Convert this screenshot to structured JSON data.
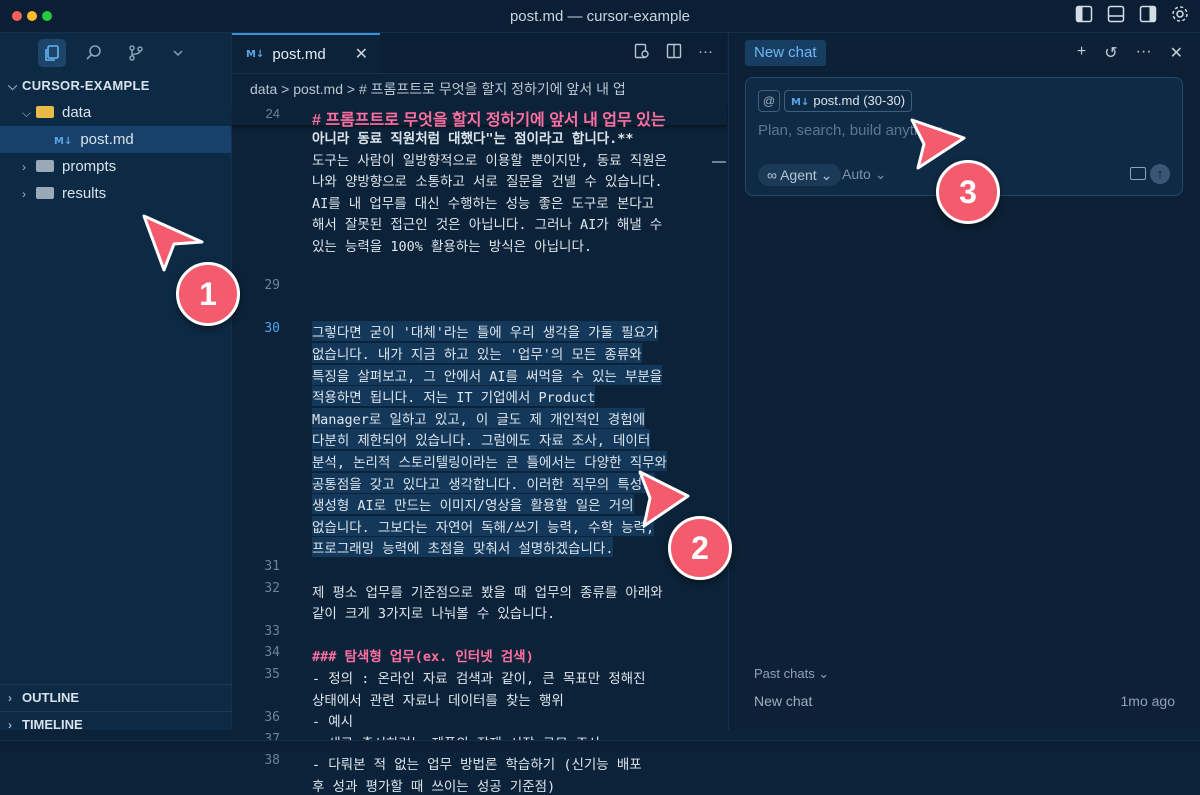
{
  "window": {
    "title": "post.md — cursor-example",
    "colors": {
      "close": "#ff5f57",
      "minimize": "#febc2e",
      "zoom": "#28c840",
      "accent": "#3b8ede",
      "marker": "#f45b6d"
    }
  },
  "sidebar": {
    "activity_icons": [
      "explorer-icon",
      "search-icon",
      "source-control-icon",
      "chevron-down-icon"
    ],
    "section_title": "CURSOR-EXAMPLE",
    "tree": [
      {
        "label": "data",
        "type": "folder",
        "open": true
      },
      {
        "label": "post.md",
        "type": "md-file",
        "selected": true
      },
      {
        "label": "prompts",
        "type": "folder",
        "open": false
      },
      {
        "label": "results",
        "type": "folder",
        "open": false
      }
    ],
    "outline": "OUTLINE",
    "timeline": "TIMELINE"
  },
  "editor": {
    "tab_label": "post.md",
    "tab_close": "✕",
    "breadcrumb": "data > post.md > # 프롬프트로 무엇을 할지 정하기에 앞서 내 업",
    "sticky_header": "# 프롬프트로 무엇을 할지 정하기에 앞서 내 업무 있는",
    "lines": [
      {
        "n": "",
        "t": "아니라 동료 직원처럼 대했다\"는 점이라고 합니다.**",
        "style": "bold"
      },
      {
        "n": "",
        "t": "도구는 사람이 일방향적으로 이용할 뿐이지만, 동료 직원은"
      },
      {
        "n": "",
        "t": "나와 양방향으로 소통하고 서로 질문을 건넬 수 있습니다."
      },
      {
        "n": "",
        "t": "AI를 내 업무를 대신 수행하는 성능 좋은 도구로 본다고"
      },
      {
        "n": "",
        "t": "해서 잘못된 접근인 것은 아닙니다. 그러나 AI가 해낼 수"
      },
      {
        "n": "",
        "t": "있는 능력을 100% 활용하는 방식은 아닙니다."
      },
      {
        "n": "",
        "t": ""
      },
      {
        "n": "29",
        "t": ""
      },
      {
        "n": "",
        "t": ""
      },
      {
        "n": "30",
        "t": "그렇다면 굳이 '대체'라는 틀에 우리 생각을 가둘 필요가",
        "style": "hl",
        "cur": true
      },
      {
        "n": "",
        "t": "없습니다. 내가 지금 하고 있는 '업무'의 모든 종류와",
        "style": "hl"
      },
      {
        "n": "",
        "t": "특징을 살펴보고, 그 안에서 AI를 써먹을 수 있는 부분을",
        "style": "hl"
      },
      {
        "n": "",
        "t": "적용하면 됩니다. 저는 IT 기업에서 Product",
        "style": "hl"
      },
      {
        "n": "",
        "t": "Manager로 일하고 있고, 이 글도 제 개인적인 경험에",
        "style": "hl"
      },
      {
        "n": "",
        "t": "다분히 제한되어 있습니다. 그럼에도 자료 조사, 데이터",
        "style": "hl"
      },
      {
        "n": "",
        "t": "분석, 논리적 스토리텔링이라는 큰 틀에서는 다양한 직무와",
        "style": "hl"
      },
      {
        "n": "",
        "t": "공통점을 갖고 있다고 생각합니다. 이러한 직무의 특성상",
        "style": "hl"
      },
      {
        "n": "",
        "t": "생성형 AI로 만드는 이미지/영상을 활용할 일은 거의",
        "style": "hl"
      },
      {
        "n": "",
        "t": "없습니다. 그보다는 자연어 독해/쓰기 능력, 수학 능력,",
        "style": "hl"
      },
      {
        "n": "",
        "t": "프로그래밍 능력에 초점을 맞춰서 설명하겠습니다.",
        "style": "hl"
      },
      {
        "n": "31",
        "t": ""
      },
      {
        "n": "32",
        "t": "제 평소 업무를 기준점으로 봤을 때 업무의 종류를 아래와"
      },
      {
        "n": "",
        "t": "같이 크게 3가지로 나눠볼 수 있습니다."
      },
      {
        "n": "33",
        "t": ""
      },
      {
        "n": "34",
        "t": "### 탐색형 업무(ex. 인터넷 검색)",
        "style": "pink"
      },
      {
        "n": "35",
        "t": "- 정의 : 온라인 자료 검색과 같이, 큰 목표만 정해진"
      },
      {
        "n": "",
        "t": "상태에서 관련 자료나 데이터를 찾는 행위"
      },
      {
        "n": "36",
        "t": "- 예시"
      },
      {
        "n": "37",
        "t": "    - 새로 출시하려는 제품의 잠재 시장 규모 조사"
      },
      {
        "n": "38",
        "t": "    - 다뤄본 적 없는 업무 방법론 학습하기 (신기능 배포"
      },
      {
        "n": "",
        "t": "후 성과 평가할 때 쓰이는 성공 기준점)"
      }
    ],
    "first_line_number": "24"
  },
  "chat": {
    "tab_label": "New chat",
    "actions": [
      "+",
      "↺",
      "···",
      "✕"
    ],
    "context_at": "@",
    "context_pill": "post.md (30-30)",
    "placeholder": "Plan, search, build anything",
    "agent_label": "∞ Agent ⌄",
    "auto_label": "Auto ⌄",
    "past_chats": "Past chats ⌄",
    "history_item": "New chat",
    "history_ago": "1mo ago"
  },
  "markers": [
    "1",
    "2",
    "3"
  ]
}
